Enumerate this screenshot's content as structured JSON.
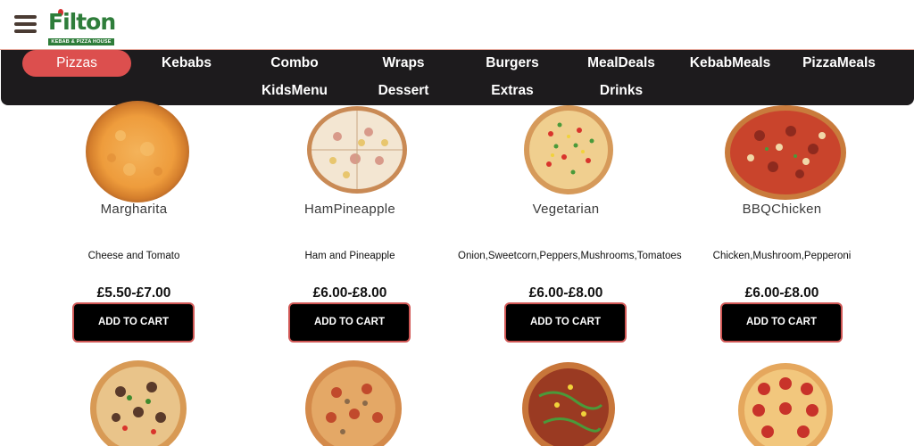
{
  "header": {
    "menu_icon": "hamburger-icon",
    "logo": {
      "text": "Filton",
      "subtitle": "KEBAB & PIZZA HOUSE"
    }
  },
  "nav": {
    "items": [
      {
        "label": "Pizzas",
        "active": true
      },
      {
        "label": "Kebabs"
      },
      {
        "label": "Combo"
      },
      {
        "label": "Wraps"
      },
      {
        "label": "Burgers"
      },
      {
        "label": "MealDeals"
      },
      {
        "label": "KebabMeals"
      },
      {
        "label": "PizzaMeals"
      },
      {
        "label": "KidsMenu"
      },
      {
        "label": "Dessert"
      },
      {
        "label": "Extras"
      },
      {
        "label": "Drinks"
      }
    ]
  },
  "products": [
    {
      "name": "Margharita",
      "description": "Cheese and Tomato",
      "price": "£5.50-£7.00",
      "button": "ADD TO CART"
    },
    {
      "name": "HamPineapple",
      "description": "Ham and Pineapple",
      "price": "£6.00-£8.00",
      "button": "ADD TO CART"
    },
    {
      "name": "Vegetarian",
      "description": "Onion,Sweetcorn,Peppers,Mushrooms,Tomatoes",
      "price": "£6.00-£8.00",
      "button": "ADD TO CART"
    },
    {
      "name": "BBQChicken",
      "description": "Chicken,Mushroom,Pepperoni",
      "price": "£6.00-£8.00",
      "button": "ADD TO CART"
    }
  ],
  "colors": {
    "accent": "#dc4f4e",
    "nav_bg": "#1d1b1d",
    "logo_green": "#2e7d3a",
    "button_bg": "#000000"
  }
}
